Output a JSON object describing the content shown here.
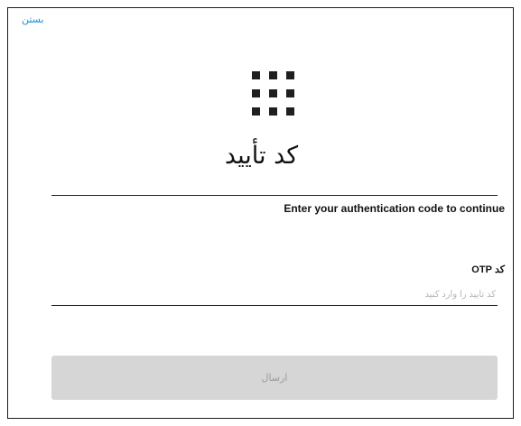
{
  "header": {
    "close_label": "بستن"
  },
  "icons": {
    "grid": "keypad-grid-icon"
  },
  "title": "کد تأیید",
  "subtitle": "Enter your authentication code to continue",
  "form": {
    "otp_label": "کد OTP",
    "otp_value": "",
    "otp_placeholder": "کد تأیید را وارد کنید",
    "submit_label": "ارسال"
  },
  "colors": {
    "link": "#1e8fd6",
    "button_bg": "#d6d6d6",
    "button_text": "#9a9a9a",
    "icon": "#1f1f1f"
  }
}
